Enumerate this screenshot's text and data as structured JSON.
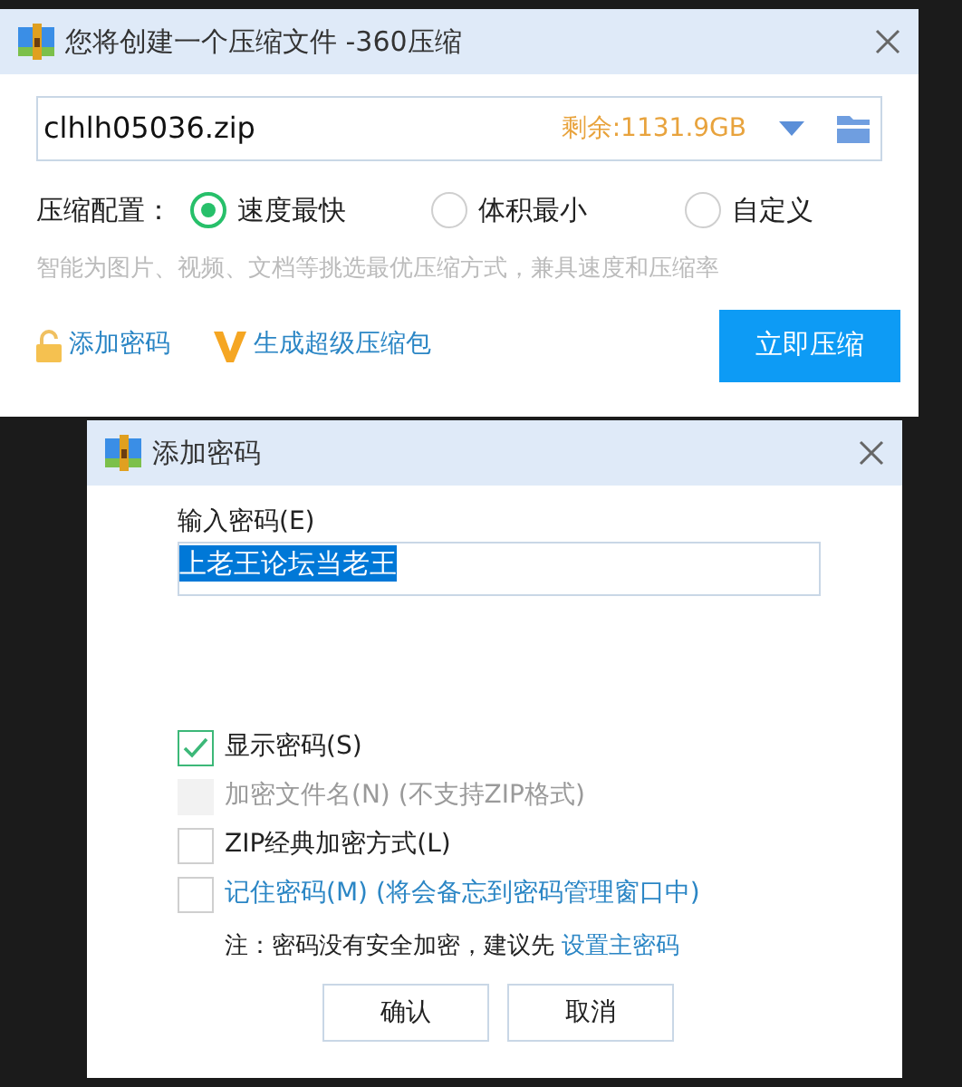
{
  "main_window": {
    "title": "您将创建一个压缩文件 -360压缩",
    "filename": "clhlh05036.zip",
    "free_space": "剩余:1131.9GB",
    "config_label": "压缩配置：",
    "options": [
      {
        "label": "速度最快",
        "selected": true
      },
      {
        "label": "体积最小",
        "selected": false
      },
      {
        "label": "自定义",
        "selected": false
      }
    ],
    "hint": "智能为图片、视频、文档等挑选最优压缩方式，兼具速度和压缩率",
    "links": [
      {
        "kind": "lock",
        "label": "添加密码"
      },
      {
        "kind": "v",
        "label": "生成超级压缩包"
      }
    ],
    "primary_button": "立即压缩"
  },
  "password_dialog": {
    "title": "添加密码",
    "field_label": "输入密码(E)",
    "password": "上老王论坛当老王",
    "checkboxes": [
      {
        "kind": "plain",
        "label": "显示密码(S)",
        "checked": true,
        "disabled": false
      },
      {
        "kind": "plain",
        "label": "加密文件名(N) (不支持ZIP格式)",
        "checked": false,
        "disabled": true
      },
      {
        "kind": "plain",
        "label": "ZIP经典加密方式(L)",
        "checked": false,
        "disabled": false
      },
      {
        "kind": "link",
        "label": "记住密码(M) (将会备忘到密码管理窗口中)",
        "checked": false,
        "disabled": false
      }
    ],
    "note": "注：密码没有安全加密，建议先",
    "note_link": "设置主密码",
    "buttons": [
      "确认",
      "取消"
    ]
  }
}
